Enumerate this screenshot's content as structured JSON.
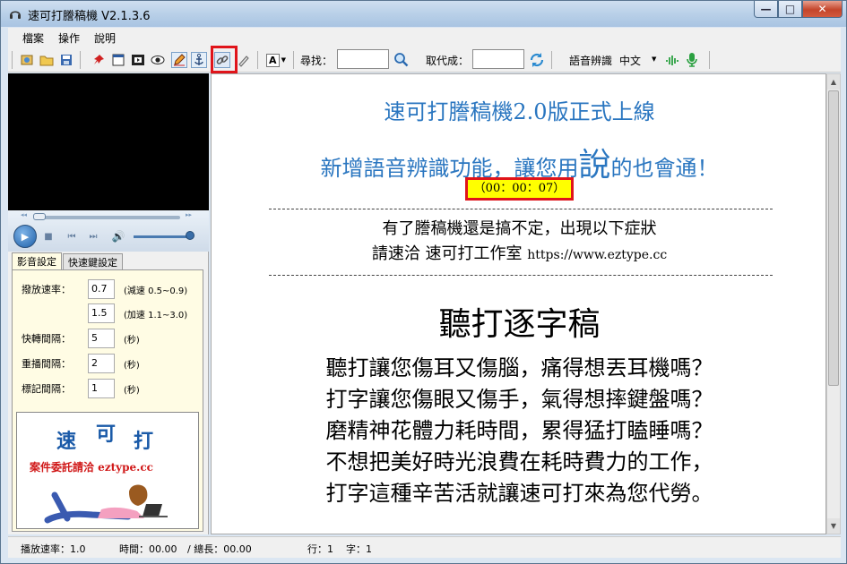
{
  "window": {
    "title": "速可打謄稿機 V2.1.3.6",
    "min_glyph": "—",
    "max_glyph": "□",
    "close_glyph": "✕"
  },
  "menu": [
    "檔案",
    "操作",
    "說明"
  ],
  "toolbar": {
    "font_button": "A",
    "search_label": "尋找：",
    "search_value": "",
    "replace_label": "取代成：",
    "replace_value": "",
    "speech_label": "語音辨識",
    "language": "中文"
  },
  "player": {
    "rewind": "◂◂",
    "forward": "▸▸"
  },
  "tabs": [
    "影音設定",
    "快速鍵設定"
  ],
  "settings": [
    {
      "label": "撥放速率：",
      "value": "0.7",
      "hint": "(減速 0.5~0.9)"
    },
    {
      "label": "",
      "value": "1.5",
      "hint": "(加速 1.1~3.0)"
    },
    {
      "label": "快轉間隔：",
      "value": "5",
      "hint": "(秒)"
    },
    {
      "label": "重播間隔：",
      "value": "2",
      "hint": "(秒)"
    },
    {
      "label": "標記間隔：",
      "value": "1",
      "hint": "(秒)"
    }
  ],
  "ad": {
    "brand_chars": [
      "速",
      "可",
      "打"
    ],
    "slogan": "案件委託請洽 eztype.cc"
  },
  "editor": {
    "headline": "速可打謄稿機2.0版正式上線",
    "subline_before": "新增語音辨識功能，讓您用",
    "subline_big": "說",
    "subline_after": "的也會通！",
    "timestamp": "（00：00：07）",
    "notice_line1": "有了謄稿機還是搞不定，出現以下症狀",
    "notice_line2_prefix": "請速洽 速可打工作室 ",
    "notice_url": "https://www.eztype.cc",
    "big_title": "聽打逐字稿",
    "body": [
      "聽打讓您傷耳又傷腦，痛得想丟耳機嗎？",
      "打字讓您傷眼又傷手，氣得想摔鍵盤嗎？",
      "磨精神花體力耗時間，累得猛打瞌睡嗎？",
      "不想把美好時光浪費在耗時費力的工作，",
      "打字這種辛苦活就讓速可打來為您代勞。"
    ]
  },
  "status": {
    "rate": "播放速率：1.0",
    "time": "時間：00.00",
    "total": "/ 總長：00.00",
    "line": "行：1",
    "chars": "字：1"
  }
}
